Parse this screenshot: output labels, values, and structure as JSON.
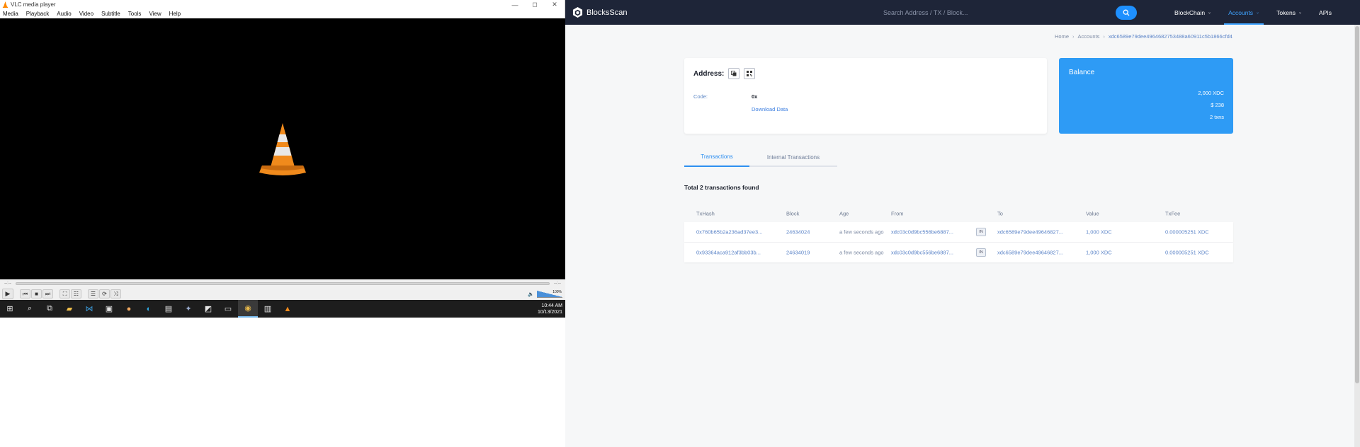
{
  "vlc": {
    "title": "VLC media player",
    "window_buttons": [
      "—",
      "◻",
      "✕"
    ],
    "menu": [
      "Media",
      "Playback",
      "Audio",
      "Video",
      "Subtitle",
      "Tools",
      "View",
      "Help"
    ],
    "time_elapsed": "--:--",
    "time_total": "--:--",
    "volume_label": "100%"
  },
  "taskbar": {
    "clock_time": "10:44 AM",
    "clock_date": "10/13/2021"
  },
  "site": {
    "brand": "BlocksScan",
    "search_placeholder": "Search Address / TX / Block...",
    "nav": [
      {
        "label": "BlockChain",
        "caret": "⌄"
      },
      {
        "label": "Accounts",
        "caret": "⌄"
      },
      {
        "label": "Tokens",
        "caret": "⌄"
      },
      {
        "label": "APIs",
        "caret": ""
      }
    ],
    "breadcrumb": {
      "home": "Home",
      "accounts": "Accounts",
      "current": "xdc6589e79dee4964682753488a60911c5b1866cfd4",
      "sep": "›"
    },
    "address_card": {
      "title": "Address:",
      "code_label": "Code:",
      "code_value": "0x",
      "download": "Download Data"
    },
    "balance_card": {
      "title": "Balance",
      "xdc": "2,000 XDC",
      "usd": "$ 238",
      "txns": "2 txns"
    },
    "tabs": [
      "Transactions",
      "Internal Transactions"
    ],
    "tx_count": "Total 2 transactions found",
    "table": {
      "headers": {
        "hash": "TxHash",
        "block": "Block",
        "age": "Age",
        "from": "From",
        "to": "To",
        "value": "Value",
        "fee": "TxFee"
      },
      "rows": [
        {
          "hash": "0x760b65b2a236ad37ee3...",
          "block": "24634024",
          "age": "a few seconds ago",
          "from": "xdc03c0d9bc556be6887...",
          "dir": "IN",
          "to": "xdc6589e79dee49646827...",
          "value": "1,000 XDC",
          "fee": "0.000005251 XDC"
        },
        {
          "hash": "0x93364aca912af3bb03b...",
          "block": "24634019",
          "age": "a few seconds ago",
          "from": "xdc03c0d9bc556be6887...",
          "dir": "IN",
          "to": "xdc6589e79dee49646827...",
          "value": "1,000 XDC",
          "fee": "0.000005251 XDC"
        }
      ]
    }
  }
}
